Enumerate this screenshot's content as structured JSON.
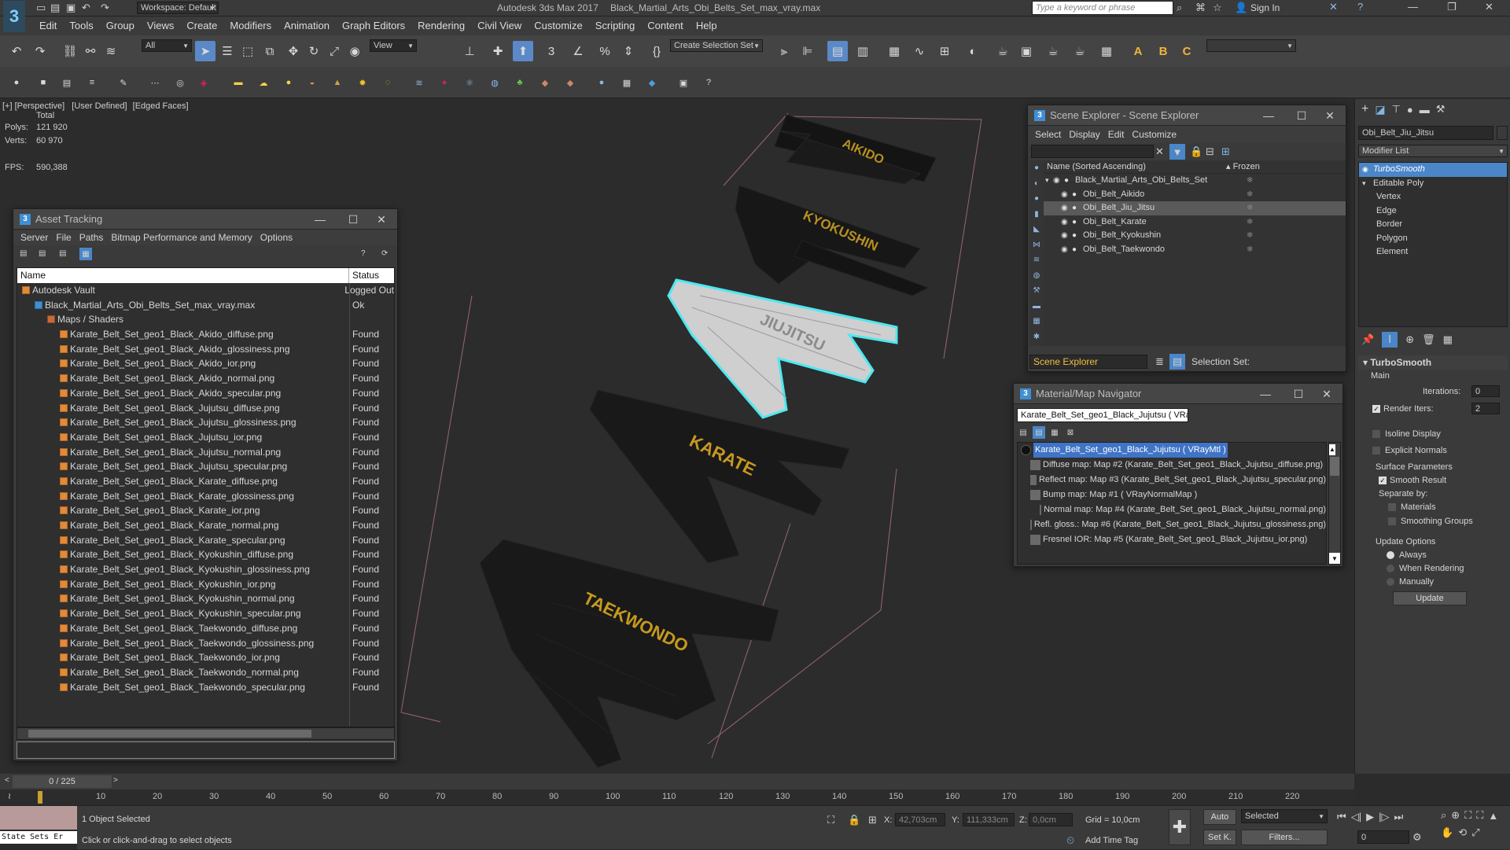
{
  "app": {
    "title": "Autodesk 3ds Max 2017",
    "file": "Black_Martial_Arts_Obi_Belts_Set_max_vray.max",
    "workspace": "Workspace: Default",
    "search_placeholder": "Type a keyword or phrase",
    "signin": "Sign In"
  },
  "menu": [
    "Edit",
    "Tools",
    "Group",
    "Views",
    "Create",
    "Modifiers",
    "Animation",
    "Graph Editors",
    "Rendering",
    "Civil View",
    "Customize",
    "Scripting",
    "Content",
    "Help"
  ],
  "toolbar": {
    "filter": "All",
    "view": "View",
    "selection_set": "Create Selection Set"
  },
  "viewport": {
    "labels": [
      "[+]",
      "[Perspective]",
      "[User Defined]",
      "[Edged Faces]"
    ],
    "stats": {
      "total_label": "Total",
      "polys_label": "Polys:",
      "polys": "121 920",
      "verts_label": "Verts:",
      "verts": "60 970",
      "fps_label": "FPS:",
      "fps": "590,388"
    },
    "belt_labels": [
      "AIKIDO",
      "KYOKUSHIN",
      "JIUJITSU",
      "KARATE",
      "TAEKWONDO"
    ]
  },
  "asset_tracking": {
    "title": "Asset Tracking",
    "menu": [
      "Server",
      "File",
      "Paths",
      "Bitmap Performance and Memory",
      "Options"
    ],
    "col_name": "Name",
    "col_status": "Status",
    "rows": [
      {
        "name": "Autodesk Vault",
        "status": "Logged Out",
        "level": 0,
        "kind": "vault"
      },
      {
        "name": "Black_Martial_Arts_Obi_Belts_Set_max_vray.max",
        "status": "Ok",
        "level": 1,
        "kind": "max"
      },
      {
        "name": "Maps / Shaders",
        "status": "",
        "level": 2,
        "kind": "folder"
      },
      {
        "name": "Karate_Belt_Set_geo1_Black_Akido_diffuse.png",
        "status": "Found",
        "level": 3,
        "kind": "file"
      },
      {
        "name": "Karate_Belt_Set_geo1_Black_Akido_glossiness.png",
        "status": "Found",
        "level": 3,
        "kind": "file"
      },
      {
        "name": "Karate_Belt_Set_geo1_Black_Akido_ior.png",
        "status": "Found",
        "level": 3,
        "kind": "file"
      },
      {
        "name": "Karate_Belt_Set_geo1_Black_Akido_normal.png",
        "status": "Found",
        "level": 3,
        "kind": "file"
      },
      {
        "name": "Karate_Belt_Set_geo1_Black_Akido_specular.png",
        "status": "Found",
        "level": 3,
        "kind": "file"
      },
      {
        "name": "Karate_Belt_Set_geo1_Black_Jujutsu_diffuse.png",
        "status": "Found",
        "level": 3,
        "kind": "file"
      },
      {
        "name": "Karate_Belt_Set_geo1_Black_Jujutsu_glossiness.png",
        "status": "Found",
        "level": 3,
        "kind": "file"
      },
      {
        "name": "Karate_Belt_Set_geo1_Black_Jujutsu_ior.png",
        "status": "Found",
        "level": 3,
        "kind": "file"
      },
      {
        "name": "Karate_Belt_Set_geo1_Black_Jujutsu_normal.png",
        "status": "Found",
        "level": 3,
        "kind": "file"
      },
      {
        "name": "Karate_Belt_Set_geo1_Black_Jujutsu_specular.png",
        "status": "Found",
        "level": 3,
        "kind": "file"
      },
      {
        "name": "Karate_Belt_Set_geo1_Black_Karate_diffuse.png",
        "status": "Found",
        "level": 3,
        "kind": "file"
      },
      {
        "name": "Karate_Belt_Set_geo1_Black_Karate_glossiness.png",
        "status": "Found",
        "level": 3,
        "kind": "file"
      },
      {
        "name": "Karate_Belt_Set_geo1_Black_Karate_ior.png",
        "status": "Found",
        "level": 3,
        "kind": "file"
      },
      {
        "name": "Karate_Belt_Set_geo1_Black_Karate_normal.png",
        "status": "Found",
        "level": 3,
        "kind": "file"
      },
      {
        "name": "Karate_Belt_Set_geo1_Black_Karate_specular.png",
        "status": "Found",
        "level": 3,
        "kind": "file"
      },
      {
        "name": "Karate_Belt_Set_geo1_Black_Kyokushin_diffuse.png",
        "status": "Found",
        "level": 3,
        "kind": "file"
      },
      {
        "name": "Karate_Belt_Set_geo1_Black_Kyokushin_glossiness.png",
        "status": "Found",
        "level": 3,
        "kind": "file"
      },
      {
        "name": "Karate_Belt_Set_geo1_Black_Kyokushin_ior.png",
        "status": "Found",
        "level": 3,
        "kind": "file"
      },
      {
        "name": "Karate_Belt_Set_geo1_Black_Kyokushin_normal.png",
        "status": "Found",
        "level": 3,
        "kind": "file"
      },
      {
        "name": "Karate_Belt_Set_geo1_Black_Kyokushin_specular.png",
        "status": "Found",
        "level": 3,
        "kind": "file"
      },
      {
        "name": "Karate_Belt_Set_geo1_Black_Taekwondo_diffuse.png",
        "status": "Found",
        "level": 3,
        "kind": "file"
      },
      {
        "name": "Karate_Belt_Set_geo1_Black_Taekwondo_glossiness.png",
        "status": "Found",
        "level": 3,
        "kind": "file"
      },
      {
        "name": "Karate_Belt_Set_geo1_Black_Taekwondo_ior.png",
        "status": "Found",
        "level": 3,
        "kind": "file"
      },
      {
        "name": "Karate_Belt_Set_geo1_Black_Taekwondo_normal.png",
        "status": "Found",
        "level": 3,
        "kind": "file"
      },
      {
        "name": "Karate_Belt_Set_geo1_Black_Taekwondo_specular.png",
        "status": "Found",
        "level": 3,
        "kind": "file"
      }
    ]
  },
  "scene_explorer": {
    "title": "Scene Explorer - Scene Explorer",
    "menu": [
      "Select",
      "Display",
      "Edit",
      "Customize"
    ],
    "col_name": "Name (Sorted Ascending)",
    "col_frozen": "▴ Frozen",
    "items": [
      {
        "name": "Black_Martial_Arts_Obi_Belts_Set",
        "level": 0,
        "selected": false
      },
      {
        "name": "Obi_Belt_Aikido",
        "level": 1,
        "selected": false
      },
      {
        "name": "Obi_Belt_Jiu_Jitsu",
        "level": 1,
        "selected": true
      },
      {
        "name": "Obi_Belt_Karate",
        "level": 1,
        "selected": false
      },
      {
        "name": "Obi_Belt_Kyokushin",
        "level": 1,
        "selected": false
      },
      {
        "name": "Obi_Belt_Taekwondo",
        "level": 1,
        "selected": false
      }
    ],
    "footer_field": "Scene Explorer",
    "selection_set_label": "Selection Set:"
  },
  "material_nav": {
    "title": "Material/Map Navigator",
    "field": "Karate_Belt_Set_geo1_Black_Jujutsu  ( VRayM",
    "items": [
      {
        "text": "Karate_Belt_Set_geo1_Black_Jujutsu  ( VRayMtl )",
        "level": 0,
        "selected": true
      },
      {
        "text": "Diffuse map: Map #2 (Karate_Belt_Set_geo1_Black_Jujutsu_diffuse.png)",
        "level": 1,
        "selected": false
      },
      {
        "text": "Reflect map: Map #3 (Karate_Belt_Set_geo1_Black_Jujutsu_specular.png)",
        "level": 1,
        "selected": false
      },
      {
        "text": "Bump map: Map #1  ( VRayNormalMap )",
        "level": 1,
        "selected": false
      },
      {
        "text": "Normal map: Map #4 (Karate_Belt_Set_geo1_Black_Jujutsu_normal.png)",
        "level": 2,
        "selected": false
      },
      {
        "text": "Refl. gloss.: Map #6 (Karate_Belt_Set_geo1_Black_Jujutsu_glossiness.png)",
        "level": 1,
        "selected": false
      },
      {
        "text": "Fresnel IOR: Map #5 (Karate_Belt_Set_geo1_Black_Jujutsu_ior.png)",
        "level": 1,
        "selected": false
      }
    ]
  },
  "command_panel": {
    "object_name": "Obi_Belt_Jiu_Jitsu",
    "modifier_list": "Modifier List",
    "stack": [
      {
        "name": "TurboSmooth",
        "level": 0,
        "selected": true
      },
      {
        "name": "Editable Poly",
        "level": 0,
        "selected": false
      },
      {
        "name": "Vertex",
        "level": 1,
        "selected": false
      },
      {
        "name": "Edge",
        "level": 1,
        "selected": false
      },
      {
        "name": "Border",
        "level": 1,
        "selected": false
      },
      {
        "name": "Polygon",
        "level": 1,
        "selected": false
      },
      {
        "name": "Element",
        "level": 1,
        "selected": false
      }
    ],
    "rollout_title": "TurboSmooth",
    "main_label": "Main",
    "iterations_label": "Iterations:",
    "iterations": "0",
    "render_iters_label": "Render Iters:",
    "render_iters": "2",
    "isoline": "Isoline Display",
    "explicit_normals": "Explicit Normals",
    "surface_params": "Surface Parameters",
    "smooth_result": "Smooth Result",
    "separate_by": "Separate by:",
    "materials": "Materials",
    "smoothing_groups": "Smoothing Groups",
    "update_options": "Update Options",
    "always": "Always",
    "when_rendering": "When Rendering",
    "manually": "Manually",
    "update": "Update"
  },
  "timeline": {
    "frame": "0 / 225",
    "ticks": [
      "10",
      "20",
      "30",
      "40",
      "50",
      "60",
      "70",
      "80",
      "90",
      "100",
      "110",
      "120",
      "130",
      "140",
      "150",
      "160",
      "170",
      "180",
      "190",
      "200",
      "210",
      "220"
    ]
  },
  "status": {
    "maxscript": "State Sets Er",
    "selected": "1 Object Selected",
    "prompt": "Click or click-and-drag to select objects",
    "x_label": "X:",
    "x": "42,703cm",
    "y_label": "Y:",
    "y": "111,333cm",
    "z_label": "Z:",
    "z": "0,0cm",
    "grid": "Grid = 10,0cm",
    "add_time_tag": "Add Time Tag",
    "auto": "Auto",
    "selected_dropdown": "Selected",
    "setk": "Set K.",
    "filters": "Filters...",
    "frame_field": "0"
  }
}
